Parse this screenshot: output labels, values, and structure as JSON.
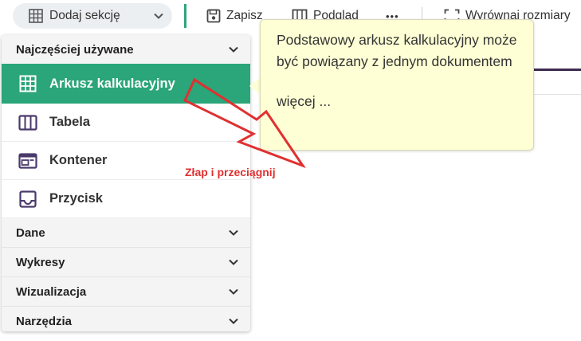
{
  "toolbar": {
    "add_section_label": "Dodaj sekcję",
    "save_label": "Zapisz",
    "preview_label": "Podgląd",
    "more_label": "•••",
    "align_label": "Wyrównaj rozmiary"
  },
  "panel": {
    "sections": [
      {
        "label": "Najczęściej używane",
        "expanded": true
      },
      {
        "label": "Dane",
        "expanded": false
      },
      {
        "label": "Wykresy",
        "expanded": false
      },
      {
        "label": "Wizualizacja",
        "expanded": false
      },
      {
        "label": "Narzędzia",
        "expanded": false
      }
    ],
    "items": [
      {
        "label": "Arkusz kalkulacyjny",
        "icon": "grid-icon",
        "active": true
      },
      {
        "label": "Tabela",
        "icon": "columns-icon",
        "active": false
      },
      {
        "label": "Kontener",
        "icon": "container-icon",
        "active": false
      },
      {
        "label": "Przycisk",
        "icon": "tray-icon",
        "active": false
      }
    ]
  },
  "tooltip": {
    "text": "Podstawowy arkusz kalkulacyjny może być powiązany z jednym dokumentem",
    "more_link": "więcej ..."
  },
  "drag_hint": {
    "label": "Złap i przeciągnij"
  },
  "colors": {
    "accent_green": "#2ba57a",
    "icon_purple": "#4a3a6b",
    "tooltip_bg": "#ffffd5",
    "hint_red": "#e03030",
    "content_bar": "#3c2a4d"
  }
}
